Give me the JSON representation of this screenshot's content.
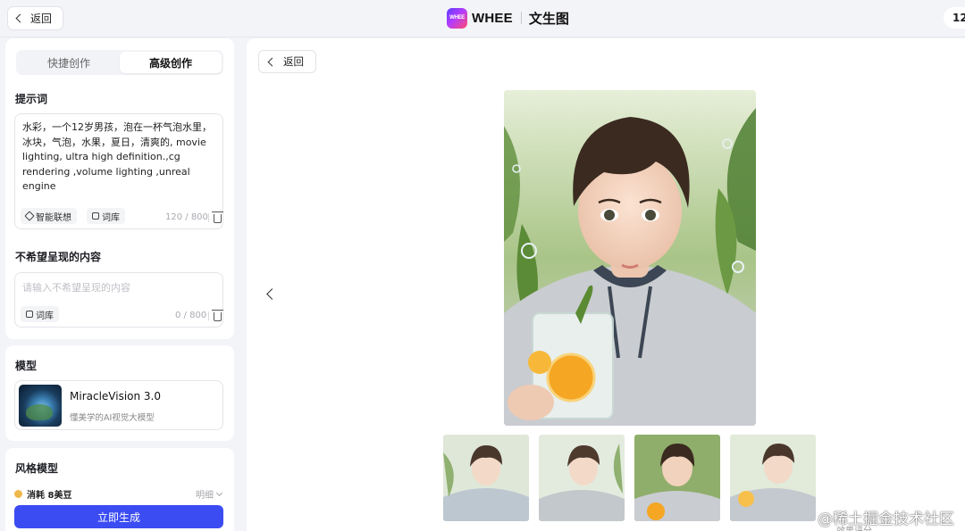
{
  "header": {
    "back_label": "返回",
    "brand_logo_text": "WHEE",
    "brand_name": "WHEE",
    "page_title": "文生图",
    "counter": "12"
  },
  "sidebar": {
    "tabs": [
      {
        "label": "快捷创作",
        "active": false
      },
      {
        "label": "高级创作",
        "active": true
      }
    ],
    "prompt": {
      "label": "提示词",
      "text": "水彩，一个12岁男孩，泡在一杯气泡水里，冰块，气泡，水果，夏日，清爽的, movie lighting, ultra high definition.,cg rendering ,volume lighting ,unreal engine",
      "chip_suggest": "智能联想",
      "chip_library": "词库",
      "count": "120 / 800"
    },
    "negative": {
      "label": "不希望呈现的内容",
      "placeholder": "请输入不希望呈现的内容",
      "chip_library": "词库",
      "count": "0 / 800"
    },
    "model": {
      "label": "模型",
      "name": "MiracleVision 3.0",
      "desc": "懂美学的AI视觉大模型"
    },
    "style": {
      "label": "风格模型",
      "cost": "消耗 8美豆",
      "detail": "明细",
      "generate": "立即生成"
    }
  },
  "main": {
    "back_label": "返回",
    "thumbnails": 4,
    "selected_thumbnail": 3
  },
  "watermark": "@稀土掘金技术社区",
  "footer_hint": "效果评分",
  "colors": {
    "accent": "#3b4cf3",
    "page_bg": "#f3f4f8"
  }
}
